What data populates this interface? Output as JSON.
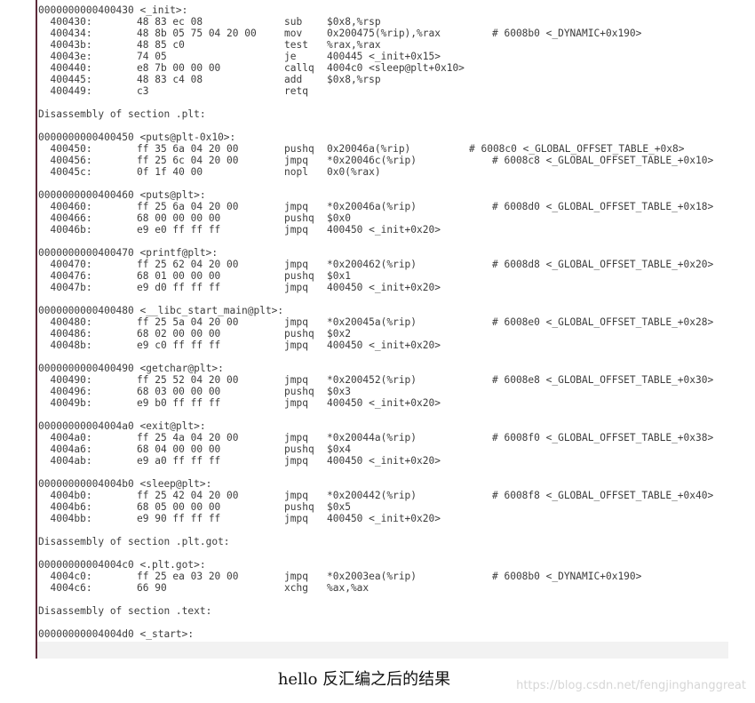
{
  "caption": "hello 反汇编之后的结果",
  "watermark": "https://blog.csdn.net/fengjinghanggreat",
  "lines": [
    {
      "addr": "0000000000400430 <_init>:"
    },
    {
      "addr": "  400430:",
      "bytes": "48 83 ec 08",
      "op": "sub",
      "args": "$0x8,%rsp"
    },
    {
      "addr": "  400434:",
      "bytes": "48 8b 05 75 04 20 00",
      "op": "mov",
      "args": "0x200475(%rip),%rax",
      "cmt": "# 6008b0 <_DYNAMIC+0x190>",
      "cpos": "a"
    },
    {
      "addr": "  40043b:",
      "bytes": "48 85 c0",
      "op": "test",
      "args": "%rax,%rax"
    },
    {
      "addr": "  40043e:",
      "bytes": "74 05",
      "op": "je",
      "args": "400445 <_init+0x15>"
    },
    {
      "addr": "  400440:",
      "bytes": "e8 7b 00 00 00",
      "op": "callq",
      "args": "4004c0 <sleep@plt+0x10>"
    },
    {
      "addr": "  400445:",
      "bytes": "48 83 c4 08",
      "op": "add",
      "args": "$0x8,%rsp"
    },
    {
      "addr": "  400449:",
      "bytes": "c3",
      "op": "retq"
    },
    {},
    {
      "addr": "Disassembly of section .plt:"
    },
    {},
    {
      "addr": "0000000000400450 <puts@plt-0x10>:"
    },
    {
      "addr": "  400450:",
      "bytes": "ff 35 6a 04 20 00",
      "op": "pushq",
      "args": "0x20046a(%rip)",
      "cmt": "# 6008c0 <_GLOBAL_OFFSET_TABLE_+0x8>",
      "cpos": "b"
    },
    {
      "addr": "  400456:",
      "bytes": "ff 25 6c 04 20 00",
      "op": "jmpq",
      "args": "*0x20046c(%rip)",
      "cmt": "# 6008c8 <_GLOBAL_OFFSET_TABLE_+0x10>",
      "cpos": "a"
    },
    {
      "addr": "  40045c:",
      "bytes": "0f 1f 40 00",
      "op": "nopl",
      "args": "0x0(%rax)"
    },
    {},
    {
      "addr": "0000000000400460 <puts@plt>:"
    },
    {
      "addr": "  400460:",
      "bytes": "ff 25 6a 04 20 00",
      "op": "jmpq",
      "args": "*0x20046a(%rip)",
      "cmt": "# 6008d0 <_GLOBAL_OFFSET_TABLE_+0x18>",
      "cpos": "a"
    },
    {
      "addr": "  400466:",
      "bytes": "68 00 00 00 00",
      "op": "pushq",
      "args": "$0x0"
    },
    {
      "addr": "  40046b:",
      "bytes": "e9 e0 ff ff ff",
      "op": "jmpq",
      "args": "400450 <_init+0x20>"
    },
    {},
    {
      "addr": "0000000000400470 <printf@plt>:"
    },
    {
      "addr": "  400470:",
      "bytes": "ff 25 62 04 20 00",
      "op": "jmpq",
      "args": "*0x200462(%rip)",
      "cmt": "# 6008d8 <_GLOBAL_OFFSET_TABLE_+0x20>",
      "cpos": "a"
    },
    {
      "addr": "  400476:",
      "bytes": "68 01 00 00 00",
      "op": "pushq",
      "args": "$0x1"
    },
    {
      "addr": "  40047b:",
      "bytes": "e9 d0 ff ff ff",
      "op": "jmpq",
      "args": "400450 <_init+0x20>"
    },
    {},
    {
      "addr": "0000000000400480 <__libc_start_main@plt>:"
    },
    {
      "addr": "  400480:",
      "bytes": "ff 25 5a 04 20 00",
      "op": "jmpq",
      "args": "*0x20045a(%rip)",
      "cmt": "# 6008e0 <_GLOBAL_OFFSET_TABLE_+0x28>",
      "cpos": "a"
    },
    {
      "addr": "  400486:",
      "bytes": "68 02 00 00 00",
      "op": "pushq",
      "args": "$0x2"
    },
    {
      "addr": "  40048b:",
      "bytes": "e9 c0 ff ff ff",
      "op": "jmpq",
      "args": "400450 <_init+0x20>"
    },
    {},
    {
      "addr": "0000000000400490 <getchar@plt>:"
    },
    {
      "addr": "  400490:",
      "bytes": "ff 25 52 04 20 00",
      "op": "jmpq",
      "args": "*0x200452(%rip)",
      "cmt": "# 6008e8 <_GLOBAL_OFFSET_TABLE_+0x30>",
      "cpos": "a"
    },
    {
      "addr": "  400496:",
      "bytes": "68 03 00 00 00",
      "op": "pushq",
      "args": "$0x3"
    },
    {
      "addr": "  40049b:",
      "bytes": "e9 b0 ff ff ff",
      "op": "jmpq",
      "args": "400450 <_init+0x20>"
    },
    {},
    {
      "addr": "00000000004004a0 <exit@plt>:"
    },
    {
      "addr": "  4004a0:",
      "bytes": "ff 25 4a 04 20 00",
      "op": "jmpq",
      "args": "*0x20044a(%rip)",
      "cmt": "# 6008f0 <_GLOBAL_OFFSET_TABLE_+0x38>",
      "cpos": "a"
    },
    {
      "addr": "  4004a6:",
      "bytes": "68 04 00 00 00",
      "op": "pushq",
      "args": "$0x4"
    },
    {
      "addr": "  4004ab:",
      "bytes": "e9 a0 ff ff ff",
      "op": "jmpq",
      "args": "400450 <_init+0x20>"
    },
    {},
    {
      "addr": "00000000004004b0 <sleep@plt>:"
    },
    {
      "addr": "  4004b0:",
      "bytes": "ff 25 42 04 20 00",
      "op": "jmpq",
      "args": "*0x200442(%rip)",
      "cmt": "# 6008f8 <_GLOBAL_OFFSET_TABLE_+0x40>",
      "cpos": "a"
    },
    {
      "addr": "  4004b6:",
      "bytes": "68 05 00 00 00",
      "op": "pushq",
      "args": "$0x5"
    },
    {
      "addr": "  4004bb:",
      "bytes": "e9 90 ff ff ff",
      "op": "jmpq",
      "args": "400450 <_init+0x20>"
    },
    {},
    {
      "addr": "Disassembly of section .plt.got:"
    },
    {},
    {
      "addr": "00000000004004c0 <.plt.got>:"
    },
    {
      "addr": "  4004c0:",
      "bytes": "ff 25 ea 03 20 00",
      "op": "jmpq",
      "args": "*0x2003ea(%rip)",
      "cmt": "# 6008b0 <_DYNAMIC+0x190>",
      "cpos": "a"
    },
    {
      "addr": "  4004c6:",
      "bytes": "66 90",
      "op": "xchg",
      "args": "%ax,%ax"
    },
    {},
    {
      "addr": "Disassembly of section .text:"
    },
    {},
    {
      "addr": "00000000004004d0 <_start>:"
    }
  ]
}
